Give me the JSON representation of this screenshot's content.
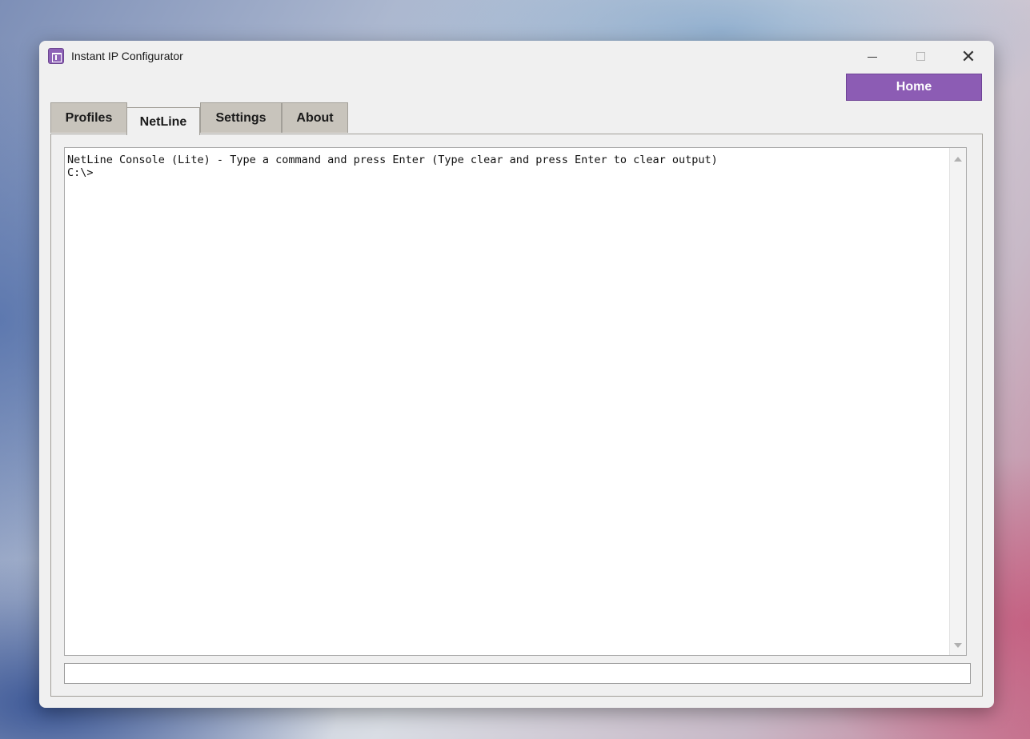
{
  "window": {
    "title": "Instant IP Configurator",
    "controls": {
      "minimize": "",
      "maximize": "",
      "close": "✕"
    }
  },
  "header": {
    "home_label": "Home"
  },
  "tabs": [
    {
      "label": "Profiles",
      "active": false
    },
    {
      "label": "NetLine",
      "active": true
    },
    {
      "label": "Settings",
      "active": false
    },
    {
      "label": "About",
      "active": false
    }
  ],
  "console": {
    "banner": "NetLine Console (Lite) - Type a command and press Enter (Type clear and press Enter to clear output)",
    "prompt": "C:\\>"
  },
  "command_input": {
    "value": "",
    "placeholder": ""
  },
  "colors": {
    "accent": "#8c5cb4",
    "tab_inactive": "#c8c4bc",
    "panel_bg": "#f0f0f0"
  }
}
